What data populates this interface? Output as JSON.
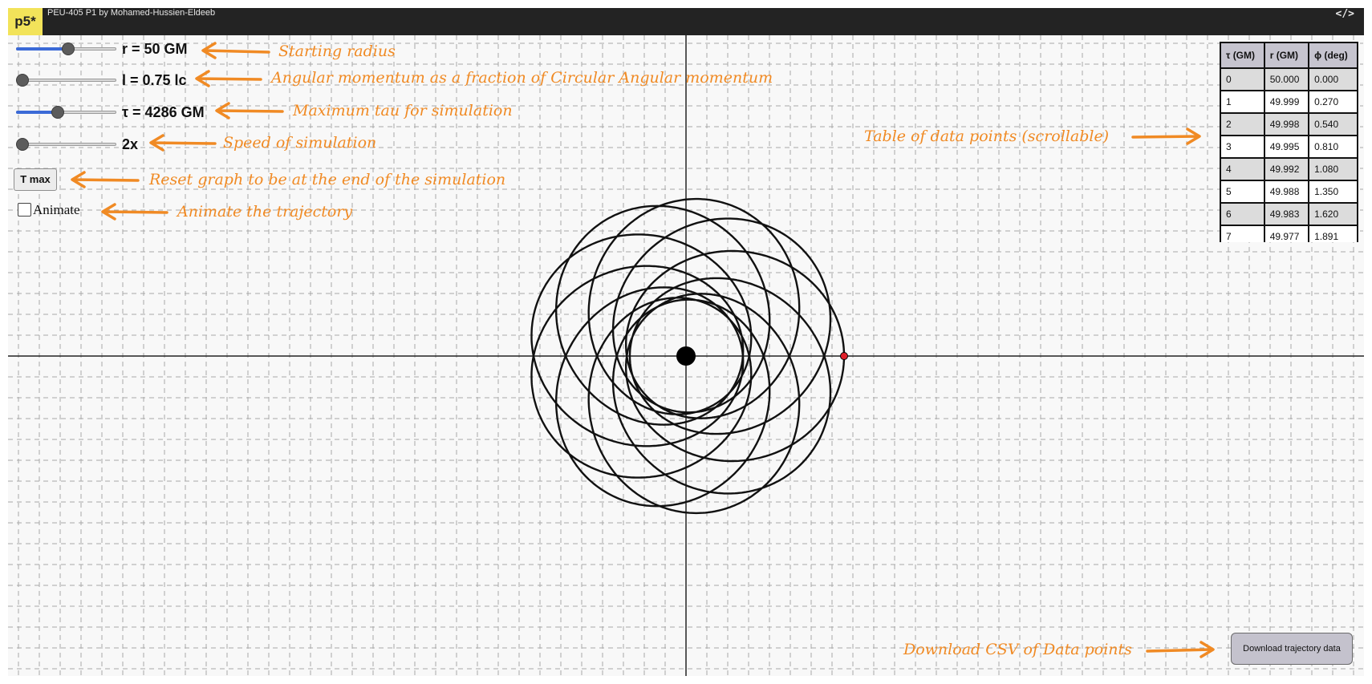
{
  "app": {
    "logo": "p5*",
    "sketch_title": "PEU-405 P1 by Mohamed-Hussien-Eldeeb",
    "code_toggle": "</>"
  },
  "controls": {
    "radius_label": "r = 50 GM",
    "radius_fraction": 0.5,
    "angular_momentum_label": "l = 0.75 lc",
    "angular_momentum_fraction": 0.0,
    "tau_label": "τ = 4286 GM",
    "tau_fraction": 0.4,
    "speed_label": "2x",
    "speed_fraction": 0.0,
    "tmax_button": "T max",
    "animate_label": "Animate",
    "animate_checked": false
  },
  "annotations": {
    "radius": "Starting radius",
    "angular_momentum": "Angular momentum as a fraction of Circular Angular momentum",
    "tau": "Maximum tau for simulation",
    "speed": "Speed of simulation",
    "tmax": "Reset graph to be at the end of the simulation",
    "animate": "Animate the trajectory",
    "table": "Table of data points (scrollable)",
    "download": "Download CSV of Data points"
  },
  "table": {
    "headers": [
      "τ (GM)",
      "r (GM)",
      "ϕ (deg)"
    ],
    "rows": [
      [
        "0",
        "50.000",
        "0.000"
      ],
      [
        "1",
        "49.999",
        "0.270"
      ],
      [
        "2",
        "49.998",
        "0.540"
      ],
      [
        "3",
        "49.995",
        "0.810"
      ],
      [
        "4",
        "49.992",
        "1.080"
      ],
      [
        "5",
        "49.988",
        "1.350"
      ],
      [
        "6",
        "49.983",
        "1.620"
      ],
      [
        "7",
        "49.977",
        "1.891"
      ]
    ]
  },
  "download_button": "Download trajectory data",
  "colors": {
    "accent": "#f08a24",
    "slider_fill": "#3b6ad7",
    "marker": "#e0202a",
    "topbar": "#232323",
    "logo_bg": "#f2e35a"
  }
}
